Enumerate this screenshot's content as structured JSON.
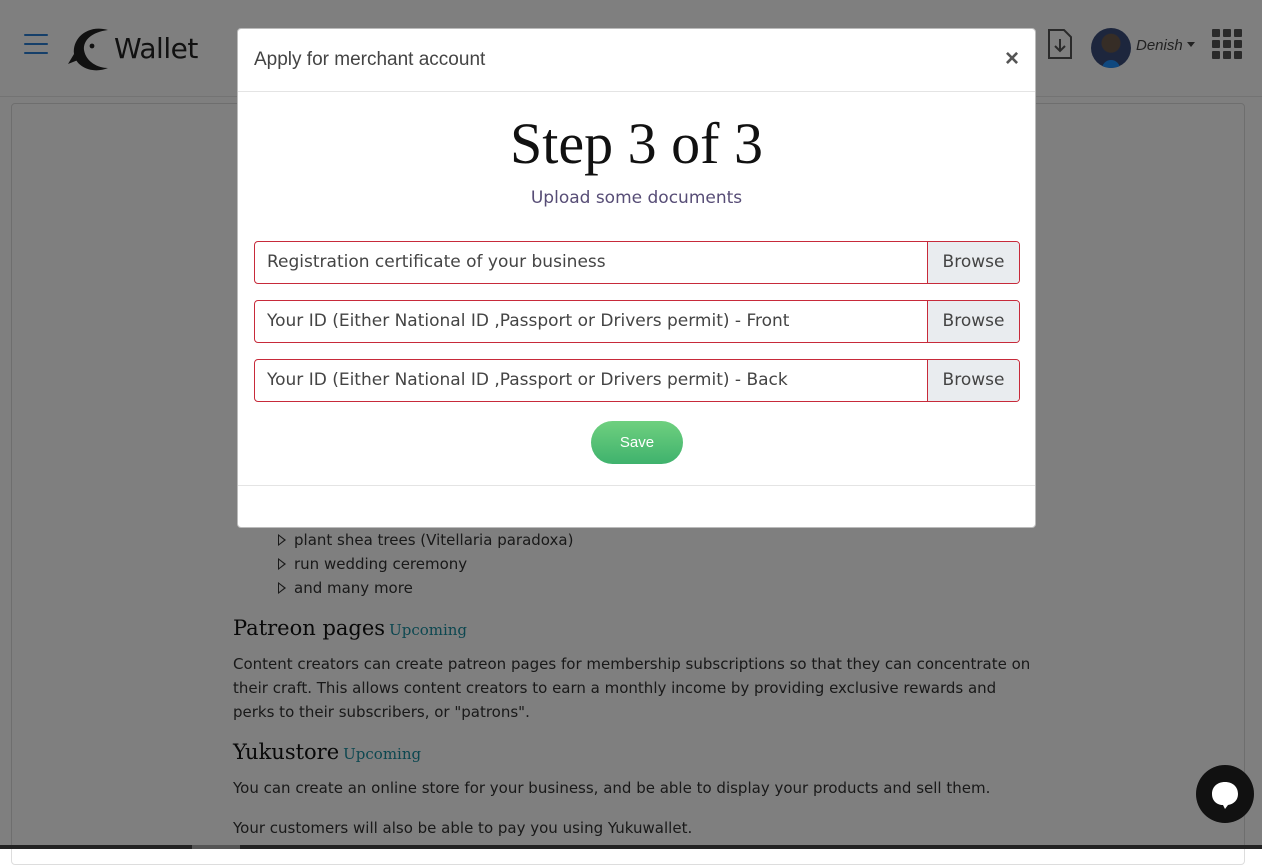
{
  "header": {
    "logo_text": "Wallet",
    "user_name": "Denish"
  },
  "background": {
    "list_items": [
      "plant shea trees (Vitellaria paradoxa)",
      "run wedding ceremony",
      "and many more"
    ],
    "patreon": {
      "title": "Patreon pages",
      "badge": "Upcoming",
      "text": "Content creators can create patreon pages for membership subscriptions so that they can concentrate on their craft. This allows content creators to earn a monthly income by providing exclusive rewards and perks to their subscribers, or \"patrons\"."
    },
    "yukustore": {
      "title": "Yukustore",
      "badge": "Upcoming",
      "text1": "You can create an online store for your business, and be able to display your products and sell them.",
      "text2": "Your customers will also be able to pay you using Yukuwallet."
    }
  },
  "modal": {
    "title": "Apply for merchant account",
    "close_label": "×",
    "step_title": "Step 3 of 3",
    "step_subtitle": "Upload some documents",
    "file_inputs": [
      {
        "label": "Registration certificate of your business",
        "button": "Browse"
      },
      {
        "label": "Your ID (Either National ID ,Passport or Drivers permit) - Front",
        "button": "Browse"
      },
      {
        "label": "Your ID (Either National ID ,Passport or Drivers permit) - Back",
        "button": "Browse"
      }
    ],
    "save_label": "Save"
  },
  "colors": {
    "accent_blue": "#2a7fd4",
    "error_border": "#c72a3a",
    "save_green": "#4cbf74",
    "badge_teal": "#1a8fa0"
  }
}
